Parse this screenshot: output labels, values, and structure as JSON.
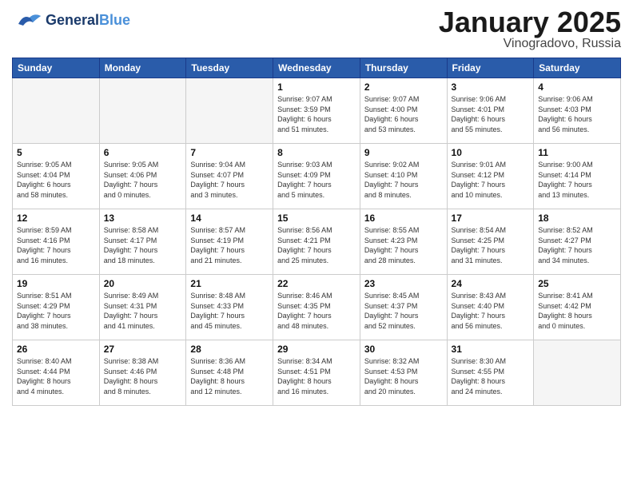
{
  "header": {
    "logo_general": "General",
    "logo_blue": "Blue",
    "title": "January 2025",
    "location": "Vinogradovo, Russia"
  },
  "weekdays": [
    "Sunday",
    "Monday",
    "Tuesday",
    "Wednesday",
    "Thursday",
    "Friday",
    "Saturday"
  ],
  "weeks": [
    [
      {
        "day": "",
        "info": ""
      },
      {
        "day": "",
        "info": ""
      },
      {
        "day": "",
        "info": ""
      },
      {
        "day": "1",
        "info": "Sunrise: 9:07 AM\nSunset: 3:59 PM\nDaylight: 6 hours\nand 51 minutes."
      },
      {
        "day": "2",
        "info": "Sunrise: 9:07 AM\nSunset: 4:00 PM\nDaylight: 6 hours\nand 53 minutes."
      },
      {
        "day": "3",
        "info": "Sunrise: 9:06 AM\nSunset: 4:01 PM\nDaylight: 6 hours\nand 55 minutes."
      },
      {
        "day": "4",
        "info": "Sunrise: 9:06 AM\nSunset: 4:03 PM\nDaylight: 6 hours\nand 56 minutes."
      }
    ],
    [
      {
        "day": "5",
        "info": "Sunrise: 9:05 AM\nSunset: 4:04 PM\nDaylight: 6 hours\nand 58 minutes."
      },
      {
        "day": "6",
        "info": "Sunrise: 9:05 AM\nSunset: 4:06 PM\nDaylight: 7 hours\nand 0 minutes."
      },
      {
        "day": "7",
        "info": "Sunrise: 9:04 AM\nSunset: 4:07 PM\nDaylight: 7 hours\nand 3 minutes."
      },
      {
        "day": "8",
        "info": "Sunrise: 9:03 AM\nSunset: 4:09 PM\nDaylight: 7 hours\nand 5 minutes."
      },
      {
        "day": "9",
        "info": "Sunrise: 9:02 AM\nSunset: 4:10 PM\nDaylight: 7 hours\nand 8 minutes."
      },
      {
        "day": "10",
        "info": "Sunrise: 9:01 AM\nSunset: 4:12 PM\nDaylight: 7 hours\nand 10 minutes."
      },
      {
        "day": "11",
        "info": "Sunrise: 9:00 AM\nSunset: 4:14 PM\nDaylight: 7 hours\nand 13 minutes."
      }
    ],
    [
      {
        "day": "12",
        "info": "Sunrise: 8:59 AM\nSunset: 4:16 PM\nDaylight: 7 hours\nand 16 minutes."
      },
      {
        "day": "13",
        "info": "Sunrise: 8:58 AM\nSunset: 4:17 PM\nDaylight: 7 hours\nand 18 minutes."
      },
      {
        "day": "14",
        "info": "Sunrise: 8:57 AM\nSunset: 4:19 PM\nDaylight: 7 hours\nand 21 minutes."
      },
      {
        "day": "15",
        "info": "Sunrise: 8:56 AM\nSunset: 4:21 PM\nDaylight: 7 hours\nand 25 minutes."
      },
      {
        "day": "16",
        "info": "Sunrise: 8:55 AM\nSunset: 4:23 PM\nDaylight: 7 hours\nand 28 minutes."
      },
      {
        "day": "17",
        "info": "Sunrise: 8:54 AM\nSunset: 4:25 PM\nDaylight: 7 hours\nand 31 minutes."
      },
      {
        "day": "18",
        "info": "Sunrise: 8:52 AM\nSunset: 4:27 PM\nDaylight: 7 hours\nand 34 minutes."
      }
    ],
    [
      {
        "day": "19",
        "info": "Sunrise: 8:51 AM\nSunset: 4:29 PM\nDaylight: 7 hours\nand 38 minutes."
      },
      {
        "day": "20",
        "info": "Sunrise: 8:49 AM\nSunset: 4:31 PM\nDaylight: 7 hours\nand 41 minutes."
      },
      {
        "day": "21",
        "info": "Sunrise: 8:48 AM\nSunset: 4:33 PM\nDaylight: 7 hours\nand 45 minutes."
      },
      {
        "day": "22",
        "info": "Sunrise: 8:46 AM\nSunset: 4:35 PM\nDaylight: 7 hours\nand 48 minutes."
      },
      {
        "day": "23",
        "info": "Sunrise: 8:45 AM\nSunset: 4:37 PM\nDaylight: 7 hours\nand 52 minutes."
      },
      {
        "day": "24",
        "info": "Sunrise: 8:43 AM\nSunset: 4:40 PM\nDaylight: 7 hours\nand 56 minutes."
      },
      {
        "day": "25",
        "info": "Sunrise: 8:41 AM\nSunset: 4:42 PM\nDaylight: 8 hours\nand 0 minutes."
      }
    ],
    [
      {
        "day": "26",
        "info": "Sunrise: 8:40 AM\nSunset: 4:44 PM\nDaylight: 8 hours\nand 4 minutes."
      },
      {
        "day": "27",
        "info": "Sunrise: 8:38 AM\nSunset: 4:46 PM\nDaylight: 8 hours\nand 8 minutes."
      },
      {
        "day": "28",
        "info": "Sunrise: 8:36 AM\nSunset: 4:48 PM\nDaylight: 8 hours\nand 12 minutes."
      },
      {
        "day": "29",
        "info": "Sunrise: 8:34 AM\nSunset: 4:51 PM\nDaylight: 8 hours\nand 16 minutes."
      },
      {
        "day": "30",
        "info": "Sunrise: 8:32 AM\nSunset: 4:53 PM\nDaylight: 8 hours\nand 20 minutes."
      },
      {
        "day": "31",
        "info": "Sunrise: 8:30 AM\nSunset: 4:55 PM\nDaylight: 8 hours\nand 24 minutes."
      },
      {
        "day": "",
        "info": ""
      }
    ]
  ]
}
